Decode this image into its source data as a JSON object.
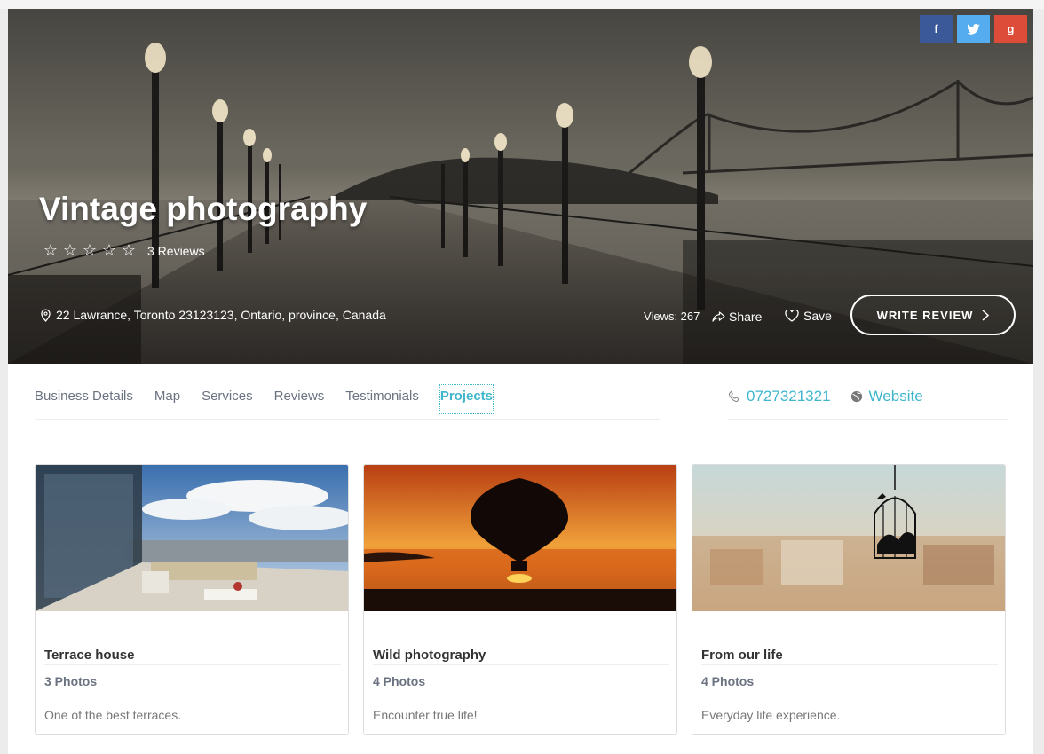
{
  "social": [
    {
      "name": "facebook",
      "icon": "facebook-icon",
      "glyph": "f",
      "color": "#3b5998"
    },
    {
      "name": "twitter",
      "icon": "twitter-icon",
      "glyph": "t",
      "color": "#55acee"
    },
    {
      "name": "googleplus",
      "icon": "google-plus-icon",
      "glyph": "g",
      "color": "#dd4b39"
    }
  ],
  "listing": {
    "title": "Vintage photography",
    "rating": 0,
    "reviews_label": "3 Reviews",
    "address": "22 Lawrance, Toronto 23123123, Ontario, province, Canada",
    "views_label": "Views: 267",
    "share_label": "Share",
    "save_label": "Save",
    "write_review_label": "WRITE REVIEW"
  },
  "tabs": [
    {
      "label": "Business Details"
    },
    {
      "label": "Map"
    },
    {
      "label": "Services"
    },
    {
      "label": "Reviews"
    },
    {
      "label": "Testimonials"
    },
    {
      "label": "Projects",
      "active": true
    }
  ],
  "contact": {
    "phone": "0727321321",
    "website": "Website"
  },
  "projects": [
    {
      "name": "Terrace house",
      "count": "3 Photos",
      "description": "One of the best terraces."
    },
    {
      "name": "Wild photography",
      "count": "4 Photos",
      "description": "Encounter true life!"
    },
    {
      "name": "From our life",
      "count": "4 Photos",
      "description": "Everyday life experience."
    }
  ],
  "colors": {
    "accent": "#3fb6cc",
    "muted": "#6b7280"
  }
}
